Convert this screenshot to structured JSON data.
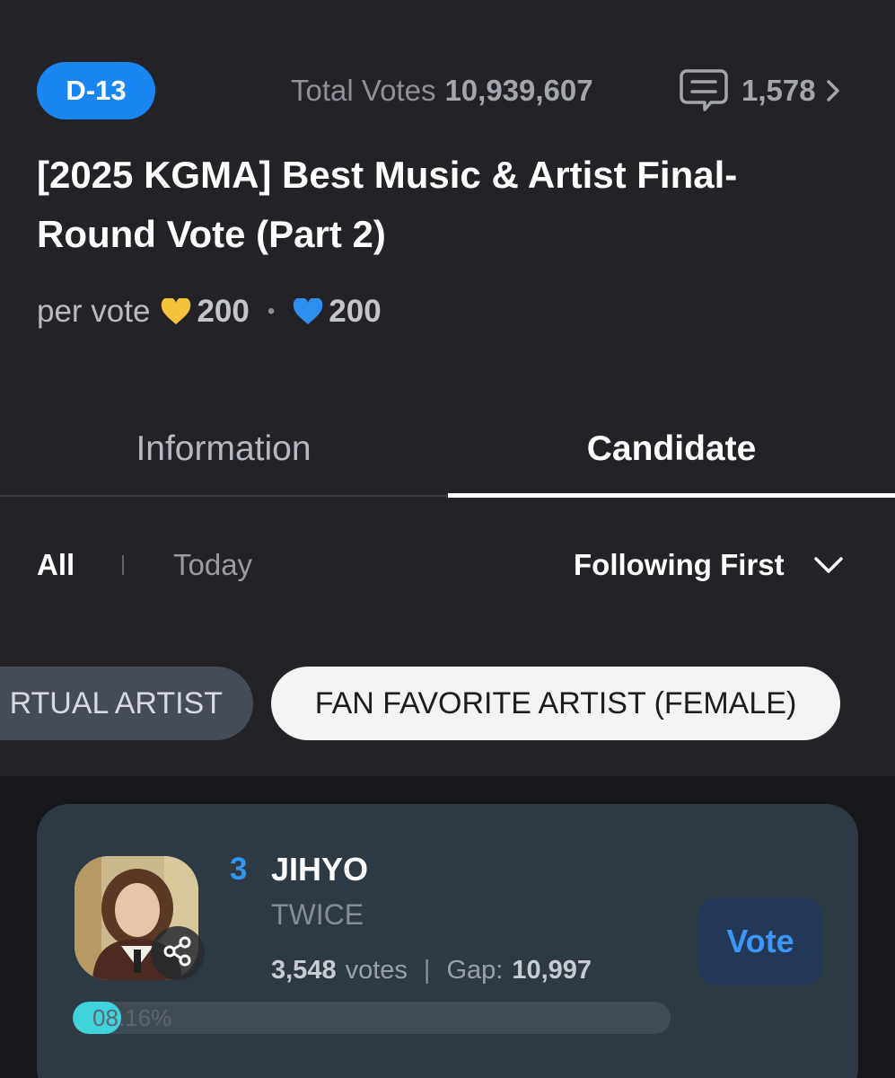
{
  "header": {
    "dday": "D-13",
    "total_votes_label": "Total Votes",
    "total_votes_value": "10,939,607",
    "comment_icon": "comment-icon",
    "comment_count": "1,578",
    "chevron_icon": "chevron-right-icon"
  },
  "title": "[2025 KGMA] Best Music & Artist Final-Round Vote (Part 2)",
  "per_vote": {
    "label": "per vote",
    "gold_heart_icon": "gold-heart-icon",
    "gold_amount": "200",
    "separator": "•",
    "blue_heart_icon": "blue-heart-icon",
    "blue_amount": "200"
  },
  "tabs": [
    {
      "label": "Information",
      "active": false
    },
    {
      "label": "Candidate",
      "active": true
    }
  ],
  "filters": {
    "all": "All",
    "today": "Today",
    "sort_label": "Following First",
    "sort_icon": "chevron-down-icon"
  },
  "categories": [
    {
      "label": "RTUAL ARTIST",
      "selected": false
    },
    {
      "label": "FAN FAVORITE ARTIST (FEMALE)",
      "selected": true
    }
  ],
  "candidate": {
    "rank": "3",
    "name": "JIHYO",
    "group": "TWICE",
    "votes_value": "3,548",
    "votes_label": "votes",
    "divider": "|",
    "gap_label": "Gap:",
    "gap_value": "10,997",
    "vote_button": "Vote",
    "percent_text": "08.16%",
    "progress_fraction": 0.0816,
    "share_icon": "share-icon"
  },
  "colors": {
    "background": "#232327",
    "accent_blue": "#1a86f2",
    "card": "#2d3a44",
    "progress_fill": "#3fd3dc",
    "gold_heart": "#f5c33b",
    "blue_heart": "#2f8ff0"
  }
}
